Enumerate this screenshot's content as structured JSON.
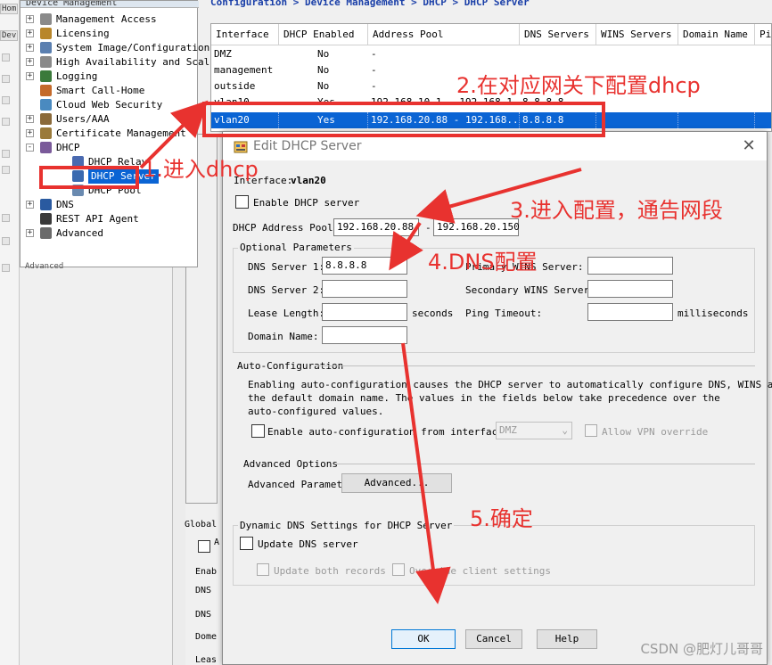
{
  "tree": {
    "header": "Device Management",
    "items": [
      {
        "label": "Management Access",
        "expander": "+"
      },
      {
        "label": "Licensing",
        "expander": "+"
      },
      {
        "label": "System Image/Configuration",
        "expander": "+"
      },
      {
        "label": "High Availability and Scal",
        "expander": "+"
      },
      {
        "label": "Logging",
        "expander": "+"
      },
      {
        "label": "Smart Call-Home",
        "expander": ""
      },
      {
        "label": "Cloud Web Security",
        "expander": ""
      },
      {
        "label": "Users/AAA",
        "expander": "+"
      },
      {
        "label": "Certificate Management",
        "expander": "+"
      },
      {
        "label": "DHCP",
        "expander": "-"
      },
      {
        "label": "DHCP Relay",
        "expander": ""
      },
      {
        "label": "DHCP Server",
        "expander": ""
      },
      {
        "label": "DHCP Pool",
        "expander": ""
      },
      {
        "label": "DNS",
        "expander": "+"
      },
      {
        "label": "REST API Agent",
        "expander": ""
      },
      {
        "label": "Advanced",
        "expander": "+"
      }
    ],
    "tail_label": "Advanced"
  },
  "left_fragments": [
    "Hom",
    "Dev"
  ],
  "breadcrumb": "Configuration > Device Management > DHCP > DHCP Server",
  "table": {
    "columns": [
      "Interface",
      "DHCP Enabled",
      "Address Pool",
      "DNS Servers",
      "WINS Servers",
      "Domain Name",
      "Pin"
    ],
    "rows": [
      [
        "DMZ",
        "No",
        "-",
        "",
        "",
        "",
        ""
      ],
      [
        "management",
        "No",
        "-",
        "",
        "",
        "",
        ""
      ],
      [
        "outside",
        "No",
        "-",
        "",
        "",
        "",
        ""
      ],
      [
        "vlan10",
        "Yes",
        "192.168.10.1 - 192.168.1...",
        "8.8.8.8",
        "",
        "",
        ""
      ],
      [
        "vlan20",
        "Yes",
        "192.168.20.88 - 192.168....",
        "8.8.8.8",
        "",
        "",
        ""
      ]
    ],
    "selected_row": 4
  },
  "main_lower": {
    "global_label": "Global",
    "labels": [
      "Enab",
      "DNS",
      "DNS",
      "Dome",
      "Leas"
    ],
    "cut_letter": "A"
  },
  "dialog": {
    "title": "Edit DHCP Server",
    "close_glyph": "✕",
    "interface_label": "Interface:",
    "interface_value": "vlan20",
    "enable_dhcp_label": "Enable DHCP server",
    "pool_label": "DHCP Address Pool:",
    "pool_start": "192.168.20.88",
    "pool_dash": "-",
    "pool_end": "192.168.20.150",
    "optional_title": "Optional Parameters",
    "dns1_label": "DNS Server 1:",
    "dns1_value": "8.8.8.8",
    "dns2_label": "DNS Server 2:",
    "dns2_value": "",
    "lease_label": "Lease Length:",
    "lease_value": "",
    "seconds_label": "seconds",
    "domain_label": "Domain Name:",
    "domain_value": "",
    "wins1_label": "Primary WINS Server:",
    "wins2_label": "Secondary WINS Server:",
    "ping_label": "Ping Timeout:",
    "ms_label": "milliseconds",
    "auto_title": "Auto-Configuration",
    "auto_desc_1": "Enabling auto-configuration causes the DHCP server to automatically configure DNS, WINS and",
    "auto_desc_2": "the default domain name. The values in the fields below take precedence over the",
    "auto_desc_3": "auto-configured values.",
    "auto_enable_label": "Enable auto-configuration from interface:",
    "auto_iface_value": "DMZ",
    "allow_vpn_label": "Allow VPN override",
    "adv_title": "Advanced Options",
    "adv_params_label": "Advanced Parameters :",
    "adv_button": "Advanced...",
    "ddns_title": "Dynamic DNS Settings for DHCP Server",
    "update_dns_label": "Update DNS server",
    "update_both_label": "Update both records",
    "override_label": "Override client settings",
    "ok": "OK",
    "cancel": "Cancel",
    "help": "Help"
  },
  "annotations": {
    "step1": "1.进入dhcp",
    "step2": "2.在对应网关下配置dhcp",
    "step3": "3.进入配置，通告网段",
    "step4": "4.DNS配置",
    "step5": "5.确定",
    "color": "#e8322f"
  },
  "watermark": "CSDN @肥灯儿哥哥"
}
